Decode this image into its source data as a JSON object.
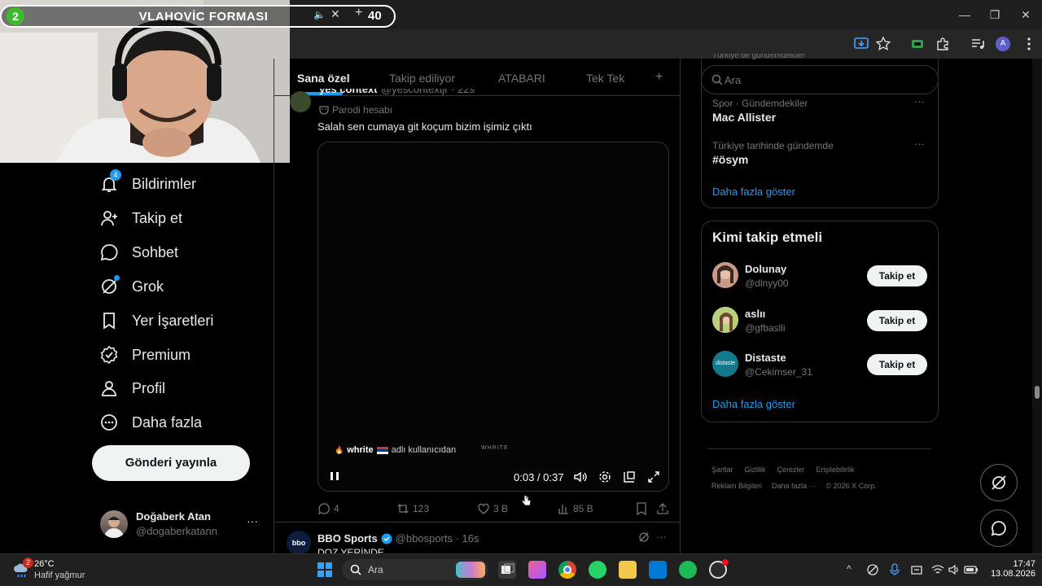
{
  "overlay": {
    "badge": "2",
    "title": "VLAHOVİC FORMASI",
    "count": "40"
  },
  "browser": {
    "minimize": "—",
    "restore": "❐",
    "close": "✕",
    "profile_initial": "A"
  },
  "sidebar": {
    "items": [
      {
        "label": "Bildirimler",
        "badge": "4"
      },
      {
        "label": "Takip et"
      },
      {
        "label": "Sohbet"
      },
      {
        "label": "Grok"
      },
      {
        "label": "Yer İşaretleri"
      },
      {
        "label": "Premium"
      },
      {
        "label": "Profil"
      },
      {
        "label": "Daha fazla"
      }
    ],
    "post_button": "Gönderi yayınla",
    "account": {
      "name": "Doğaberk Atan",
      "handle": "@dogaberkatann",
      "more": "···"
    }
  },
  "feed": {
    "tabs": [
      "Sana özel",
      "Takip ediliyor",
      "ATABARI",
      "Tek Tek"
    ],
    "add_tab": "+",
    "post1": {
      "author_partial": "yes context",
      "handle_partial": "@yescontextjr · 22s",
      "parody": "Parodi hesabı",
      "text": "Salah sen cumaya git koçum bizim işimiz çıktı",
      "video": {
        "credit_user": "whrite",
        "credit_suffix": "adlı kullanıcıdan",
        "watermark": "WHRITE",
        "time": "0:03 / 0:37",
        "progress": 0.08
      },
      "replies": "4",
      "reposts": "123",
      "likes": "3 B",
      "views": "85 B"
    },
    "post2": {
      "author": "BBO Sports",
      "handle": "@bbosports · 16s",
      "avatar_text": "bbo",
      "text_partial": "DOZ YERİNDE",
      "more": "···"
    }
  },
  "right": {
    "search_placeholder": "Ara",
    "trends_header_partial": "Türkiye'de gündemdekiler",
    "trends": [
      {
        "meta": "Spor · Gündemdekiler",
        "name": "Mac Allister"
      },
      {
        "meta": "Türkiye tarihinde gündemde",
        "name": "#ösym"
      }
    ],
    "trends_more": "Daha fazla göster",
    "who_title": "Kimi takip etmeli",
    "who": [
      {
        "name": "Dolunay",
        "handle": "@dlnyy00"
      },
      {
        "name": "aslıı",
        "handle": "@gfbaslli"
      },
      {
        "name": "Distaste",
        "handle": "@Cekimser_31",
        "avatar_text": "distaste"
      }
    ],
    "follow_label": "Takip et",
    "who_more": "Daha fazla göster",
    "footer_row1": [
      "Şartlar",
      "Gizlilik",
      "Çerezler",
      "Erişilebilirlik"
    ],
    "footer_row2": [
      "Reklam Bilgileri",
      "Daha fazla ···",
      "© 2026 X Corp."
    ]
  },
  "taskbar": {
    "weather_badge": "2",
    "temp": "26°C",
    "weather": "Hafif yağmur",
    "search_placeholder": "Ara",
    "time": "17:47",
    "date": "13.08.2026"
  },
  "colors": {
    "accent": "#1d9bf0",
    "bg": "#000000",
    "muted": "#71767b"
  }
}
